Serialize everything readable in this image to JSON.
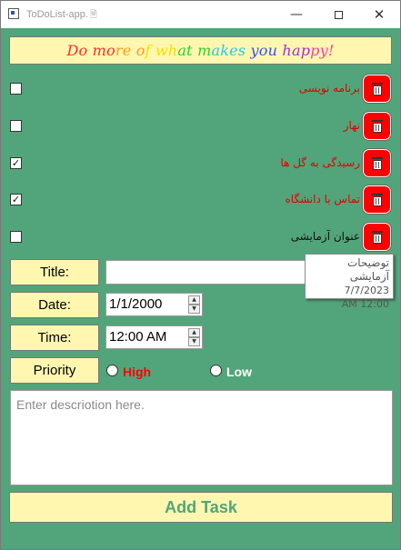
{
  "window": {
    "title": "ToDoList-app.",
    "title_icon": "document-icon",
    "minimize_glyph": "—",
    "close_glyph": "✕"
  },
  "banner": {
    "text": "Do more of what makes you happy!",
    "colors": [
      "#ff2a2a",
      "#ff9a1a",
      "#f0e000",
      "#2bcf2b",
      "#24c8e8",
      "#3a4dff",
      "#a42bd8",
      "#ff3fa0"
    ]
  },
  "tasks": [
    {
      "title": "برنامه نویسی",
      "checked": false,
      "color": "#e00000"
    },
    {
      "title": "نهار",
      "checked": false,
      "color": "#e00000"
    },
    {
      "title": "رسیدگی به گل ها",
      "checked": true,
      "color": "#e00000"
    },
    {
      "title": "تماس با دانشگاه",
      "checked": true,
      "color": "#e00000"
    },
    {
      "title": "عنوان آزمایشی",
      "checked": false,
      "color": "#111111"
    }
  ],
  "tooltip": {
    "description": "توضیحات آزمایشی",
    "date": "7/7/2023",
    "time": "AM 12:00"
  },
  "form": {
    "title_label": "Title:",
    "title_value": "",
    "date_label": "Date:",
    "date_value": "1/1/2000",
    "time_label": "Time:",
    "time_value": "12:00 AM",
    "priority_label": "Priority",
    "priority_high": "High",
    "priority_low": "Low",
    "priority_high_color": "#ff0000",
    "priority_low_color": "#ffffff",
    "description_placeholder": "Enter descriotion here.",
    "add_button": "Add Task",
    "add_button_color": "#52a57a"
  },
  "colors": {
    "background": "#52a57a",
    "panel": "#fff7b0",
    "delete_button": "#ff0000"
  }
}
